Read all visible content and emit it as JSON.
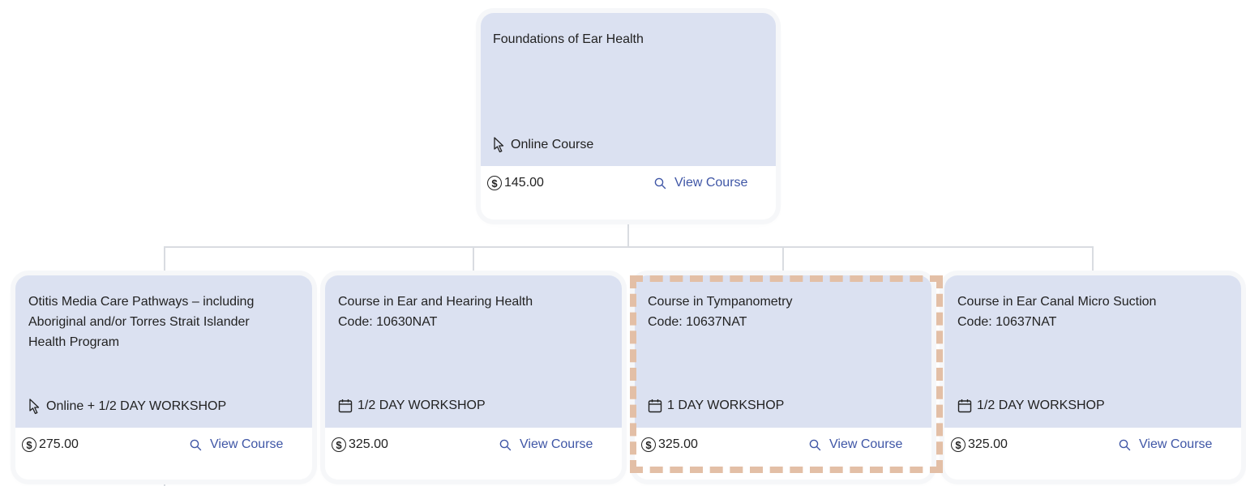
{
  "root_course": {
    "title": "Foundations of Ear Health",
    "format": "Online Course",
    "format_icon": "cursor-icon",
    "price": "145.00",
    "view_label": "View Course"
  },
  "courses": [
    {
      "title": "Otitis Media Care Pathways – including Aboriginal and/or Torres Strait Islander Health Program",
      "format": "Online + 1/2 DAY WORKSHOP",
      "format_icon": "cursor-icon",
      "price": "275.00",
      "view_label": "View Course"
    },
    {
      "title": "Course in Ear and Hearing Health\nCode: 10630NAT",
      "format": "1/2 DAY WORKSHOP",
      "format_icon": "calendar-icon",
      "price": "325.00",
      "view_label": "View Course"
    },
    {
      "title": "Course in Tympanometry\nCode: 10637NAT",
      "format": "1 DAY WORKSHOP",
      "format_icon": "calendar-icon",
      "price": "325.00",
      "view_label": "View Course",
      "highlighted": true
    },
    {
      "title": "Course in Ear Canal Micro Suction\nCode: 10637NAT",
      "format": "1/2 DAY WORKSHOP",
      "format_icon": "calendar-icon",
      "price": "325.00",
      "view_label": "View Course"
    }
  ],
  "currency_symbol": "$",
  "colors": {
    "card_header_bg": "#dbe1f1",
    "link": "#3f56a6",
    "connector": "#d9dce1",
    "highlight_border": "#e3bfa6"
  }
}
